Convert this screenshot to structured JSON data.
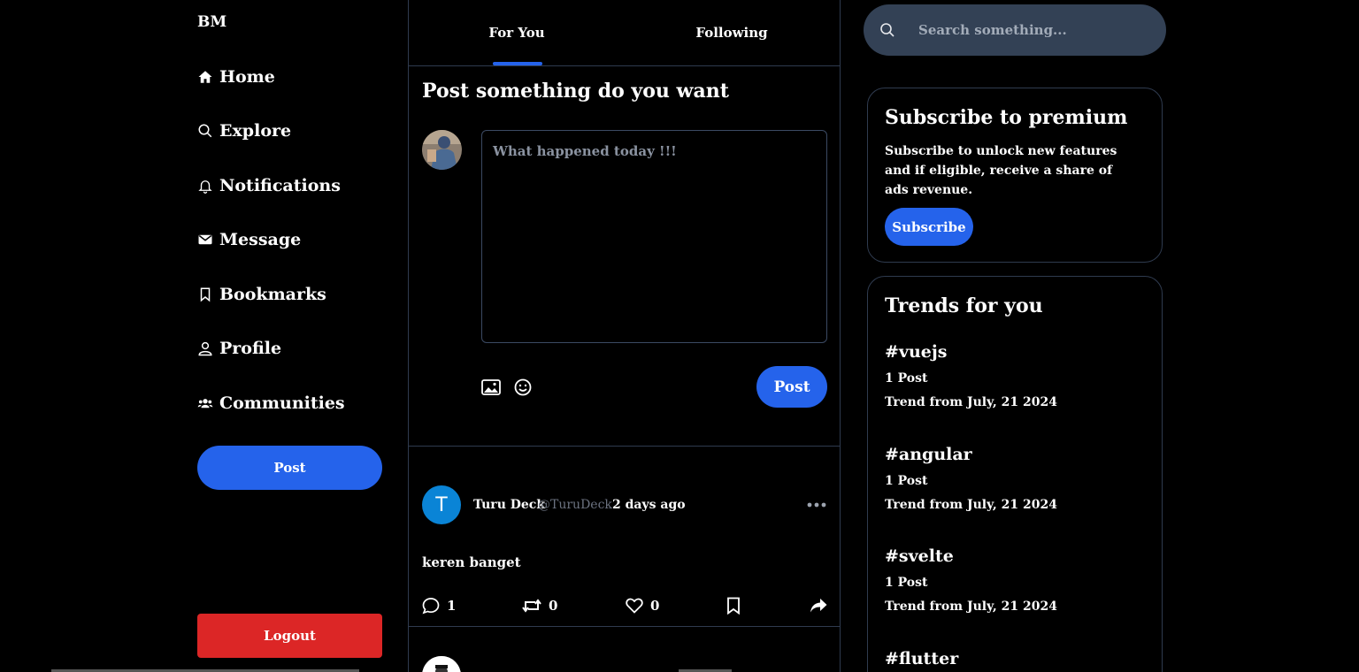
{
  "sidebar": {
    "brand": "BM",
    "items": [
      {
        "label": "Home",
        "icon": "home-icon"
      },
      {
        "label": "Explore",
        "icon": "search-icon"
      },
      {
        "label": "Notifications",
        "icon": "bell-icon"
      },
      {
        "label": "Message",
        "icon": "envelope-icon"
      },
      {
        "label": "Bookmarks",
        "icon": "bookmark-icon"
      },
      {
        "label": "Profile",
        "icon": "user-icon"
      },
      {
        "label": "Communities",
        "icon": "users-icon"
      }
    ],
    "post_label": "Post",
    "logout_label": "Logout"
  },
  "tabs": [
    {
      "label": "For You",
      "active": true
    },
    {
      "label": "Following",
      "active": false
    }
  ],
  "compose": {
    "title": "Post something do you want",
    "placeholder": "What happened today !!!",
    "value": "",
    "post_label": "Post"
  },
  "feed": [
    {
      "avatar_letter": "T",
      "name": "Turu Deck",
      "handle": "@TuruDeck",
      "time": "2 days ago",
      "text": "keren banget",
      "comments": "1",
      "reposts": "0",
      "likes": "0"
    }
  ],
  "search": {
    "placeholder": "Search something..."
  },
  "premium": {
    "title": "Subscribe to premium",
    "description": "Subscribe to unlock new features and if eligible, receive a share of ads revenue.",
    "button_label": "Subscribe"
  },
  "trends": {
    "title": "Trends for you",
    "items": [
      {
        "tag": "#vuejs",
        "count": "1 Post",
        "date": "Trend from July, 21 2024"
      },
      {
        "tag": "#angular",
        "count": "1 Post",
        "date": "Trend from July, 21 2024"
      },
      {
        "tag": "#svelte",
        "count": "1 Post",
        "date": "Trend from July, 21 2024"
      },
      {
        "tag": "#flutter",
        "count": "",
        "date": ""
      }
    ]
  },
  "colors": {
    "accent": "#2563eb",
    "danger": "#dc2626",
    "border": "#2f3b4f",
    "search_bg": "#334155"
  }
}
